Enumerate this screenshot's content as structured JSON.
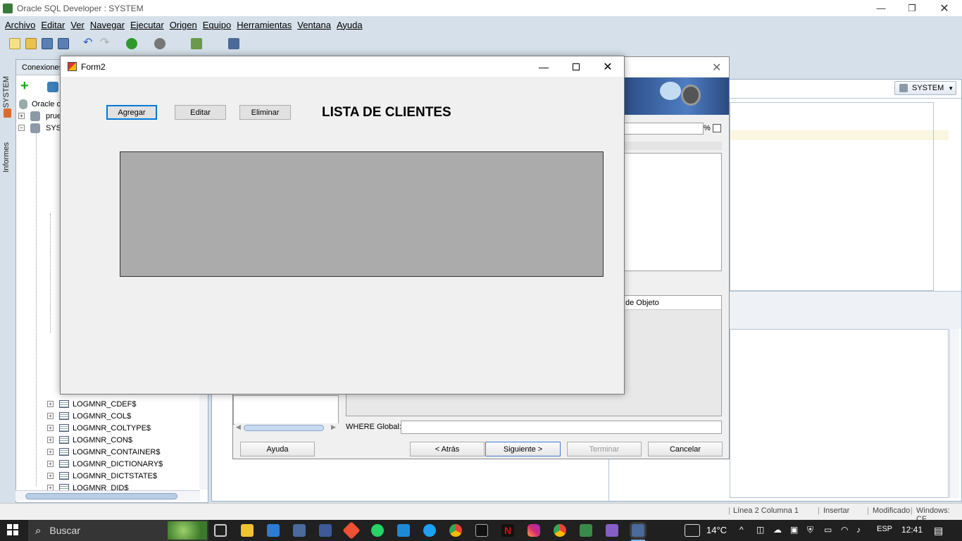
{
  "app": {
    "title": "Oracle SQL Developer : SYSTEM",
    "menu": [
      "Archivo",
      "Editar",
      "Ver",
      "Navegar",
      "Ejecutar",
      "Origen",
      "Equipo",
      "Herramientas",
      "Ventana",
      "Ayuda"
    ]
  },
  "left_strip": {
    "tab1": "SYSTEM",
    "tab2": "Informes"
  },
  "connections": {
    "header": "Conexiones",
    "root": "Oracle co",
    "items": [
      "prue",
      "SYST"
    ],
    "tables": [
      "LOGMNR_CDEF$",
      "LOGMNR_COL$",
      "LOGMNR_COLTYPE$",
      "LOGMNR_CON$",
      "LOGMNR_CONTAINER$",
      "LOGMNR_DICTIONARY$",
      "LOGMNR_DICTSTATE$",
      "LOGMNR_DID$"
    ]
  },
  "right": {
    "schema_selector": "SYSTEM"
  },
  "wizard": {
    "percent": "%",
    "object_header": "de Objeto",
    "where_label": "WHERE Global:",
    "btn_help": "Ayuda",
    "btn_back": "< Atrás",
    "btn_next": "Siguiente >",
    "btn_finish": "Terminar",
    "btn_cancel": "Cancelar"
  },
  "form2": {
    "title": "Form2",
    "btn_add": "Agregar",
    "btn_edit": "Editar",
    "btn_delete": "Eliminar",
    "heading": "LISTA DE CLIENTES"
  },
  "status": {
    "position": "Línea 2 Columna 1",
    "mode": "Insertar",
    "modified": "Modificado",
    "eol": "Windows: CF"
  },
  "taskbar": {
    "search": "Buscar",
    "temp": "14°C",
    "lang": "ESP",
    "time": "12:41"
  },
  "colors": {
    "accent": "#0078d7",
    "ide_bg": "#d5e0ea",
    "grid": "#ababab"
  }
}
